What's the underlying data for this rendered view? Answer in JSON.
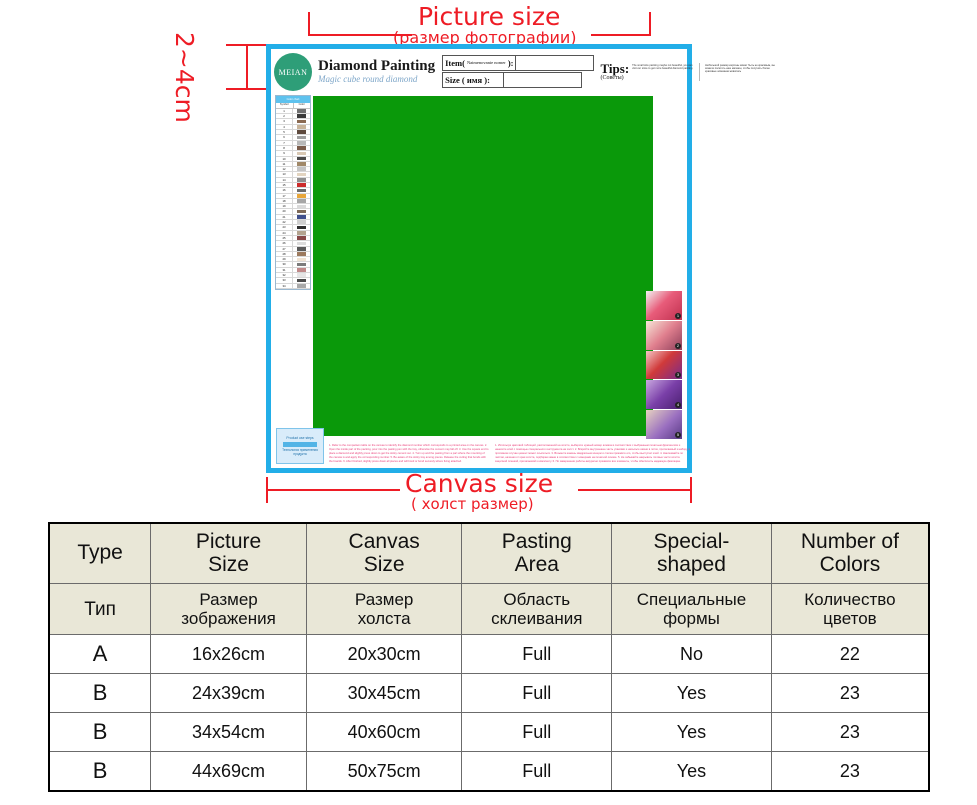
{
  "annotations": {
    "picture_size_en": "Picture size",
    "picture_size_ru": "(размер фотографии)",
    "canvas_size_en": "Canvas size",
    "canvas_size_ru": "( холст размер)",
    "margin_label": "2~4cm",
    "accent_red": "#ee1c25",
    "border_blue": "#22aee8",
    "artwork_green": "#0a990a"
  },
  "sheet": {
    "logo_text": "MEIAN",
    "brand_title": "Diamond Painting",
    "brand_subtitle": "Magic cube round diamond",
    "field_item_label": "Item(",
    "field_item_ru": "Naimenovanie\nnomer",
    "field_item_close": "):",
    "field_size_label": "Size ( имя ):",
    "field_item_value": "",
    "field_size_value": "",
    "tips_en": "Tips:",
    "tips_ru": "(Советы)",
    "tips_micro_en": "The small size painting maybe not beautiful, you can visit our store to get more beautiful diamond painting",
    "tips_micro_ru": "Небольшой размер картины может быть не красивым, вы можете посетить наш магазин, чтобы получить более красивые алмазная живопись",
    "legend_caption": "Color chart",
    "legend_col1": "Symbol",
    "legend_col2": "Color",
    "steps_title": "Product use steps",
    "steps_sub": "Технология применения продукта",
    "instructions_en": "1. Refer to the comparison table on the canvas to identify the diamond number which corresponds to a printed area on the canvas. 2. Open the inside part of the packing, pour into the pasting pen with the tray, otherwise the cement may fall off. 3. Use the square end to place a diamond and slightly press down to get the sticky cement out. 4. Turn up and the pasting from a part where the mounting of the canvas is and apply the corresponding number. 5. Be aware of the sticky tray among pieces. Release the cutting that bonds with the boards. 6. After finished, slightly press down all pieces and will bond or bond securely where fixing attached.",
    "instructions_ru": "1. Используя цветовой таблицей, расположенной на холсте, выберите нужный номер алмаза в соответствии с выбранным печатным фрагментом и нанесите клей с помощью специального инструмента на холст. 2. Вскройте внутреннюю часть упаковки и насыпьте камни в лоток, прилагаемый к набору, в противном случае цемент может осыпаться. 3. Возьмите камень квадратным концом и слегка прижмите его, чтобы выступил клей. 4. Наклеивайте по частям, начиная от края холста, подбирая камни в соответствии с номерами на печатной основе. 5. Не забывайте накрывать готовые части холста защитной пленкой, прилагаемой к комплекту. 6. По завершении работы аккуратно прижмите все элементы, чтобы обеспечить надежную фиксацию.",
    "color_swatches": [
      "#6f6f6f",
      "#3a3a3a",
      "#8a6a52",
      "#c8b49a",
      "#5e4a3e",
      "#9e9e9e",
      "#b8b8b8",
      "#7a5b4a",
      "#d8c8b4",
      "#4a4a4a",
      "#a08868",
      "#c4c4c4",
      "#e2d4c0",
      "#8e8e8e",
      "#cc2b2b",
      "#6b6b6b",
      "#e8a63a",
      "#a6a6a6",
      "#d9d9d9",
      "#7e6a58",
      "#3f4f8c",
      "#cfcfcf",
      "#2e2e2e",
      "#b4a490",
      "#884848",
      "#dcdcdc",
      "#5a5a5a",
      "#9c7a5e",
      "#efe2d2",
      "#7c7c7c",
      "#c08a8a",
      "#e6e6e6",
      "#4c4c4c",
      "#a9a9a9"
    ],
    "photo_badges": [
      "1",
      "2",
      "3",
      "4",
      "5"
    ]
  },
  "table": {
    "headers_en": [
      "Type",
      "Picture Size",
      "Canvas Size",
      "Pasting Area",
      "Special- shaped",
      "Number of Colors"
    ],
    "headers_en_lines": [
      [
        "Type"
      ],
      [
        "Picture",
        "Size"
      ],
      [
        "Canvas",
        "Size"
      ],
      [
        "Pasting",
        "Area"
      ],
      [
        "Special-",
        "shaped"
      ],
      [
        "Number of",
        "Colors"
      ]
    ],
    "headers_ru_lines": [
      [
        "Тип"
      ],
      [
        "Размер",
        "зображения"
      ],
      [
        "Размер",
        "холста"
      ],
      [
        "Область",
        "склеивания"
      ],
      [
        "Специальные",
        "формы"
      ],
      [
        "Количество",
        "цветов"
      ]
    ],
    "rows": [
      {
        "type": "A",
        "picture_size": "16x26cm",
        "canvas_size": "20x30cm",
        "pasting_area": "Full",
        "special_shaped": "No",
        "number_of_colors": "22"
      },
      {
        "type": "B",
        "picture_size": "24x39cm",
        "canvas_size": "30x45cm",
        "pasting_area": "Full",
        "special_shaped": "Yes",
        "number_of_colors": "23"
      },
      {
        "type": "B",
        "picture_size": "34x54cm",
        "canvas_size": "40x60cm",
        "pasting_area": "Full",
        "special_shaped": "Yes",
        "number_of_colors": "23"
      },
      {
        "type": "B",
        "picture_size": "44x69cm",
        "canvas_size": "50x75cm",
        "pasting_area": "Full",
        "special_shaped": "Yes",
        "number_of_colors": "23"
      }
    ],
    "header_bg": "#e9e7d7"
  }
}
